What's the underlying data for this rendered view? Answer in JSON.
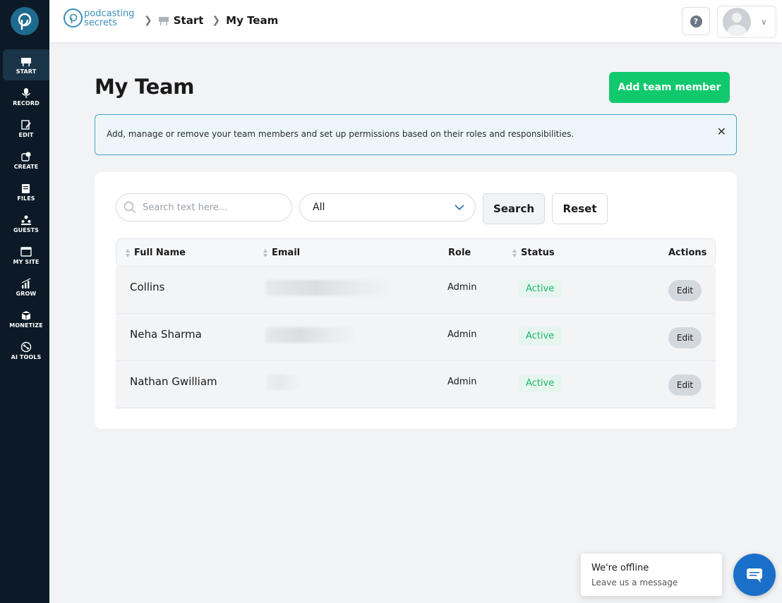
{
  "sidebar": {
    "items": [
      {
        "label": "START",
        "icon": "start-icon",
        "active": true
      },
      {
        "label": "RECORD",
        "icon": "microphone-icon"
      },
      {
        "label": "EDIT",
        "icon": "edit-icon"
      },
      {
        "label": "CREATE",
        "icon": "create-icon"
      },
      {
        "label": "FILES",
        "icon": "files-icon"
      },
      {
        "label": "GUESTS",
        "icon": "guests-icon"
      },
      {
        "label": "MY SITE",
        "icon": "site-icon"
      },
      {
        "label": "GROW",
        "icon": "grow-icon"
      },
      {
        "label": "MONETIZE",
        "icon": "monetize-icon"
      },
      {
        "label": "AI TOOLS",
        "icon": "ai-tools-icon"
      }
    ]
  },
  "header": {
    "brand_line1": "podcasting",
    "brand_line2": "secrets",
    "breadcrumbs": [
      "Start",
      "My Team"
    ]
  },
  "page": {
    "title": "My Team",
    "add_button": "Add team member",
    "info_text": "Add, manage or remove your team members and set up permissions based on their roles and responsibilities."
  },
  "filters": {
    "search_placeholder": "Search text here...",
    "select_value": "All",
    "search_button": "Search",
    "reset_button": "Reset"
  },
  "table": {
    "headers": [
      "Full Name",
      "Email",
      "Role",
      "Status",
      "Actions"
    ],
    "rows": [
      {
        "name": "Collins",
        "role": "Admin",
        "status": "Active",
        "action": "Edit"
      },
      {
        "name": "Neha Sharma",
        "role": "Admin",
        "status": "Active",
        "action": "Edit"
      },
      {
        "name": "Nathan Gwilliam",
        "role": "Admin",
        "status": "Active",
        "action": "Edit"
      }
    ]
  },
  "chat": {
    "title": "We're offline",
    "subtitle": "Leave us a message"
  },
  "colors": {
    "sidebar_bg": "#0b1a26",
    "primary_green": "#11c96d",
    "status_green": "#1bb56a",
    "info_border": "#4aa8c9",
    "chat_blue": "#1a6fc9"
  }
}
